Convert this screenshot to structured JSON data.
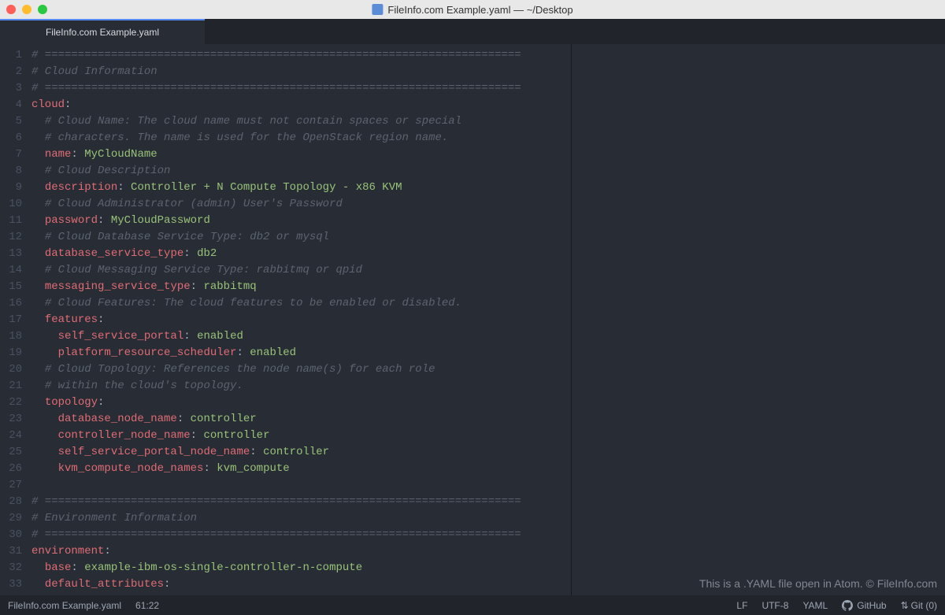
{
  "titlebar": {
    "title": "FileInfo.com Example.yaml — ~/Desktop"
  },
  "tab": {
    "label": "FileInfo.com Example.yaml"
  },
  "lines": [
    {
      "n": 1,
      "segs": [
        {
          "cls": "c-comment",
          "t": "# ========================================================================"
        }
      ]
    },
    {
      "n": 2,
      "segs": [
        {
          "cls": "c-comment",
          "t": "# Cloud Information"
        }
      ]
    },
    {
      "n": 3,
      "segs": [
        {
          "cls": "c-comment",
          "t": "# ========================================================================"
        }
      ]
    },
    {
      "n": 4,
      "segs": [
        {
          "cls": "c-key",
          "t": "cloud"
        },
        {
          "cls": "c-punct",
          "t": ":"
        }
      ]
    },
    {
      "n": 5,
      "segs": [
        {
          "cls": "",
          "t": "  "
        },
        {
          "cls": "c-comment",
          "t": "# Cloud Name: The cloud name must not contain spaces or special"
        }
      ]
    },
    {
      "n": 6,
      "segs": [
        {
          "cls": "",
          "t": "  "
        },
        {
          "cls": "c-comment",
          "t": "# characters. The name is used for the OpenStack region name."
        }
      ]
    },
    {
      "n": 7,
      "segs": [
        {
          "cls": "",
          "t": "  "
        },
        {
          "cls": "c-key",
          "t": "name"
        },
        {
          "cls": "c-punct",
          "t": ": "
        },
        {
          "cls": "c-value",
          "t": "MyCloudName"
        }
      ]
    },
    {
      "n": 8,
      "segs": [
        {
          "cls": "",
          "t": "  "
        },
        {
          "cls": "c-comment",
          "t": "# Cloud Description"
        }
      ]
    },
    {
      "n": 9,
      "segs": [
        {
          "cls": "",
          "t": "  "
        },
        {
          "cls": "c-key",
          "t": "description"
        },
        {
          "cls": "c-punct",
          "t": ": "
        },
        {
          "cls": "c-value",
          "t": "Controller + N Compute Topology - x86 KVM"
        }
      ]
    },
    {
      "n": 10,
      "segs": [
        {
          "cls": "",
          "t": "  "
        },
        {
          "cls": "c-comment",
          "t": "# Cloud Administrator (admin) User's Password"
        }
      ]
    },
    {
      "n": 11,
      "segs": [
        {
          "cls": "",
          "t": "  "
        },
        {
          "cls": "c-key",
          "t": "password"
        },
        {
          "cls": "c-punct",
          "t": ": "
        },
        {
          "cls": "c-value",
          "t": "MyCloudPassword"
        }
      ]
    },
    {
      "n": 12,
      "segs": [
        {
          "cls": "",
          "t": "  "
        },
        {
          "cls": "c-comment",
          "t": "# Cloud Database Service Type: db2 or mysql"
        }
      ]
    },
    {
      "n": 13,
      "segs": [
        {
          "cls": "",
          "t": "  "
        },
        {
          "cls": "c-key",
          "t": "database_service_type"
        },
        {
          "cls": "c-punct",
          "t": ": "
        },
        {
          "cls": "c-value",
          "t": "db2"
        }
      ]
    },
    {
      "n": 14,
      "segs": [
        {
          "cls": "",
          "t": "  "
        },
        {
          "cls": "c-comment",
          "t": "# Cloud Messaging Service Type: rabbitmq or qpid"
        }
      ]
    },
    {
      "n": 15,
      "segs": [
        {
          "cls": "",
          "t": "  "
        },
        {
          "cls": "c-key",
          "t": "messaging_service_type"
        },
        {
          "cls": "c-punct",
          "t": ": "
        },
        {
          "cls": "c-value",
          "t": "rabbitmq"
        }
      ]
    },
    {
      "n": 16,
      "segs": [
        {
          "cls": "",
          "t": "  "
        },
        {
          "cls": "c-comment",
          "t": "# Cloud Features: The cloud features to be enabled or disabled."
        }
      ]
    },
    {
      "n": 17,
      "segs": [
        {
          "cls": "",
          "t": "  "
        },
        {
          "cls": "c-key",
          "t": "features"
        },
        {
          "cls": "c-punct",
          "t": ":"
        }
      ]
    },
    {
      "n": 18,
      "segs": [
        {
          "cls": "",
          "t": "    "
        },
        {
          "cls": "c-keyl2",
          "t": "self_service_portal"
        },
        {
          "cls": "c-punct",
          "t": ": "
        },
        {
          "cls": "c-value",
          "t": "enabled"
        }
      ]
    },
    {
      "n": 19,
      "segs": [
        {
          "cls": "",
          "t": "    "
        },
        {
          "cls": "c-keyl2",
          "t": "platform_resource_scheduler"
        },
        {
          "cls": "c-punct",
          "t": ": "
        },
        {
          "cls": "c-value",
          "t": "enabled"
        }
      ]
    },
    {
      "n": 20,
      "segs": [
        {
          "cls": "",
          "t": "  "
        },
        {
          "cls": "c-comment",
          "t": "# Cloud Topology: References the node name(s) for each role"
        }
      ]
    },
    {
      "n": 21,
      "segs": [
        {
          "cls": "",
          "t": "  "
        },
        {
          "cls": "c-comment",
          "t": "# within the cloud's topology."
        }
      ]
    },
    {
      "n": 22,
      "segs": [
        {
          "cls": "",
          "t": "  "
        },
        {
          "cls": "c-key",
          "t": "topology"
        },
        {
          "cls": "c-punct",
          "t": ":"
        }
      ]
    },
    {
      "n": 23,
      "segs": [
        {
          "cls": "",
          "t": "    "
        },
        {
          "cls": "c-keyl2",
          "t": "database_node_name"
        },
        {
          "cls": "c-punct",
          "t": ": "
        },
        {
          "cls": "c-value",
          "t": "controller"
        }
      ]
    },
    {
      "n": 24,
      "segs": [
        {
          "cls": "",
          "t": "    "
        },
        {
          "cls": "c-keyl2",
          "t": "controller_node_name"
        },
        {
          "cls": "c-punct",
          "t": ": "
        },
        {
          "cls": "c-value",
          "t": "controller"
        }
      ]
    },
    {
      "n": 25,
      "segs": [
        {
          "cls": "",
          "t": "    "
        },
        {
          "cls": "c-keyl2",
          "t": "self_service_portal_node_name"
        },
        {
          "cls": "c-punct",
          "t": ": "
        },
        {
          "cls": "c-value",
          "t": "controller"
        }
      ]
    },
    {
      "n": 26,
      "segs": [
        {
          "cls": "",
          "t": "    "
        },
        {
          "cls": "c-keyl2",
          "t": "kvm_compute_node_names"
        },
        {
          "cls": "c-punct",
          "t": ": "
        },
        {
          "cls": "c-value",
          "t": "kvm_compute"
        }
      ]
    },
    {
      "n": 27,
      "segs": []
    },
    {
      "n": 28,
      "segs": [
        {
          "cls": "c-comment",
          "t": "# ========================================================================"
        }
      ]
    },
    {
      "n": 29,
      "segs": [
        {
          "cls": "c-comment",
          "t": "# Environment Information"
        }
      ]
    },
    {
      "n": 30,
      "segs": [
        {
          "cls": "c-comment",
          "t": "# ========================================================================"
        }
      ]
    },
    {
      "n": 31,
      "segs": [
        {
          "cls": "c-key",
          "t": "environment"
        },
        {
          "cls": "c-punct",
          "t": ":"
        }
      ]
    },
    {
      "n": 32,
      "segs": [
        {
          "cls": "",
          "t": "  "
        },
        {
          "cls": "c-key",
          "t": "base"
        },
        {
          "cls": "c-punct",
          "t": ": "
        },
        {
          "cls": "c-value",
          "t": "example-ibm-os-single-controller-n-compute"
        }
      ]
    },
    {
      "n": 33,
      "segs": [
        {
          "cls": "",
          "t": "  "
        },
        {
          "cls": "c-key",
          "t": "default_attributes"
        },
        {
          "cls": "c-punct",
          "t": ":"
        }
      ]
    }
  ],
  "watermark": "This is a .YAML file open in Atom. © FileInfo.com",
  "status": {
    "file": "FileInfo.com Example.yaml",
    "cursor": "61:22",
    "line_ending": "LF",
    "encoding": "UTF-8",
    "grammar": "YAML",
    "github": "GitHub",
    "git": "Git (0)"
  }
}
